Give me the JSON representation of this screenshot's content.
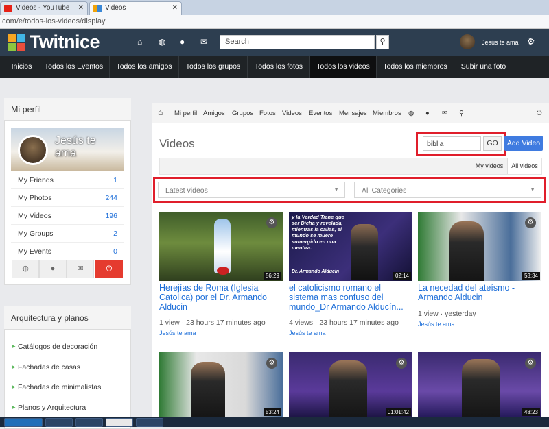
{
  "browser": {
    "tabs": [
      {
        "label": "Videos - YouTube"
      },
      {
        "label": "Videos"
      }
    ],
    "url": ".com/e/todos-los-videos/display"
  },
  "header": {
    "logo_text": "Twitnice",
    "search_placeholder": "Search",
    "username": "Jesús te ama",
    "icons": [
      "home-icon",
      "globe-icon",
      "user-icon",
      "mail-icon",
      "search-icon",
      "gear-icon"
    ]
  },
  "nav": [
    "Inicios",
    "Todos los Eventos",
    "Todos los amigos",
    "Todos los grupos",
    "Todos los fotos",
    "Todos los videos",
    "Todos los miembros",
    "Subir una foto"
  ],
  "sidebar": {
    "profile_title": "Mi perfil",
    "cover_name": "Jesús te ama",
    "stats": [
      {
        "label": "My Friends",
        "count": "1"
      },
      {
        "label": "My Photos",
        "count": "244"
      },
      {
        "label": "My Videos",
        "count": "196"
      },
      {
        "label": "My Groups",
        "count": "2"
      },
      {
        "label": "My Events",
        "count": "0"
      }
    ],
    "section_title": "Arquitectura y planos",
    "links": [
      "Catálogos de decoración",
      "Fachadas de casas",
      "Fachadas de minimalistas",
      "Planos y Arquitectura"
    ]
  },
  "subnav": [
    "Mi perfil",
    "Amigos",
    "Grupos",
    "Fotos",
    "Videos",
    "Eventos",
    "Mensajes",
    "Miembros"
  ],
  "videos": {
    "title": "Videos",
    "search_value": "biblia",
    "go_label": "GO",
    "add_label": "Add Video",
    "tab_my": "My videos",
    "tab_all": "All videos",
    "sort_select": "Latest videos",
    "category_select": "All Categories",
    "items": [
      {
        "title": "Herejías de Roma (Iglesia Catolica) por el Dr. Armando Alducin",
        "duration": "56:29",
        "views": "1 view",
        "time": "23 hours 17 minutes ago",
        "user": "Jesús te ama"
      },
      {
        "title": "el catolicismo romano el sistema mas confuso del mundo_Dr Armando Alducín...",
        "duration": "02:14",
        "views": "4 views",
        "time": "23 hours 17 minutes ago",
        "user": "Jesús te ama",
        "overlay_text": "y la Verdad Tiene que ser Dicha y revelada, mientras la callas, el mundo se muere sumergido en una mentira.",
        "caption": "Dr. Armando Alducín"
      },
      {
        "title": "La necedad del ateísmo - Armando Alducin",
        "duration": "53:34",
        "views": "1 view",
        "time": "yesterday",
        "user": "Jesús te ama"
      },
      {
        "title": "",
        "duration": "53:24",
        "views": "",
        "time": "",
        "user": ""
      },
      {
        "title": "",
        "duration": "01:01:42",
        "views": "",
        "time": "",
        "user": ""
      },
      {
        "title": "",
        "duration": "48:23",
        "views": "",
        "time": "",
        "user": ""
      }
    ]
  },
  "colors": {
    "header": "#2d3e50",
    "nav": "#1f2326",
    "link": "#1e6fd9",
    "highlight": "#e01e2b",
    "add_button": "#3f7be0"
  }
}
